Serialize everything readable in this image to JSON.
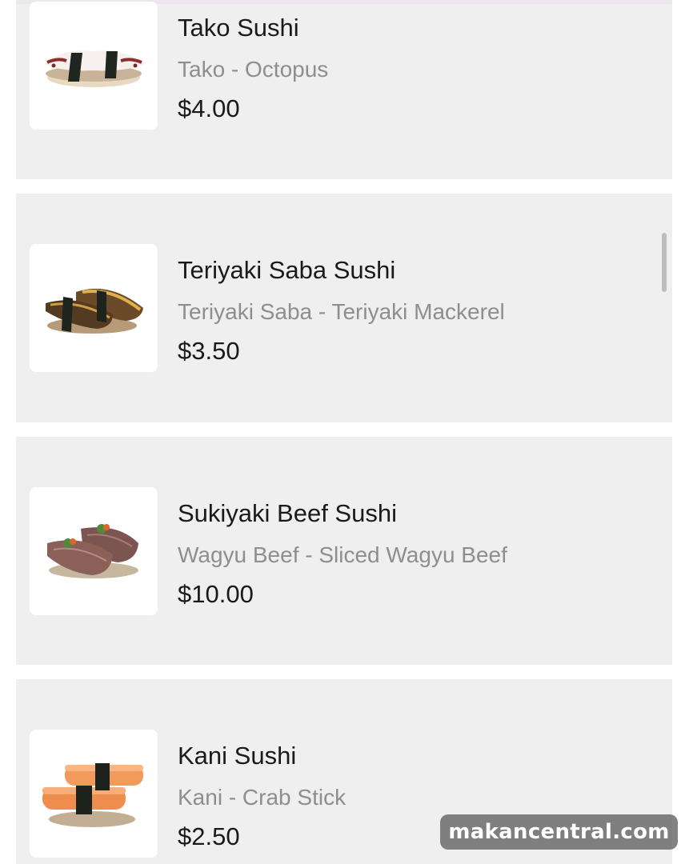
{
  "menu_items": [
    {
      "name": "Tako Sushi",
      "description": "Tako - Octopus",
      "price": "$4.00",
      "image_icon": "tako-sushi-image"
    },
    {
      "name": "Teriyaki Saba Sushi",
      "description": "Teriyaki Saba - Teriyaki Mackerel",
      "price": "$3.50",
      "image_icon": "teriyaki-saba-sushi-image"
    },
    {
      "name": "Sukiyaki Beef Sushi",
      "description": "Wagyu Beef - Sliced Wagyu Beef",
      "price": "$10.00",
      "image_icon": "sukiyaki-beef-sushi-image"
    },
    {
      "name": "Kani Sushi",
      "description": "Kani - Crab Stick",
      "price": "$2.50",
      "image_icon": "kani-sushi-image"
    }
  ],
  "watermark": {
    "text": "makancentral.com"
  },
  "colors": {
    "card_background": "#efefef",
    "name_text": "#1a1a1a",
    "description_text": "#8e8e8e"
  }
}
